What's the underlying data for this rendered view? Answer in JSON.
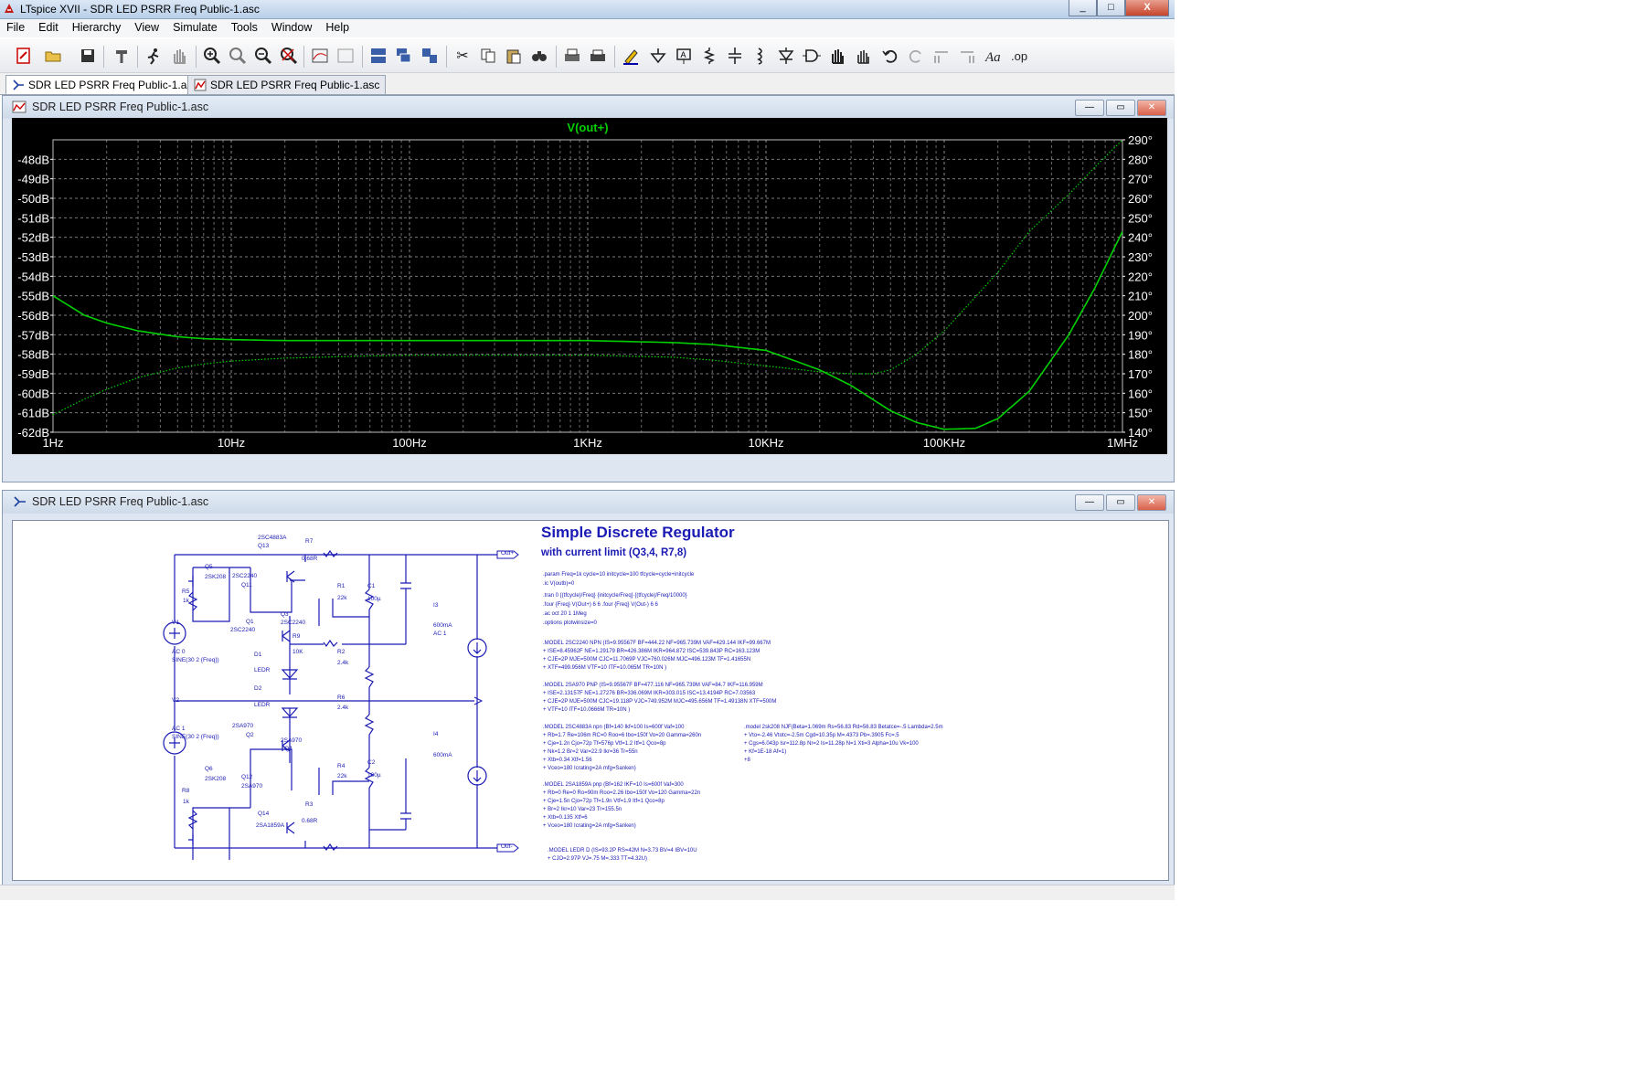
{
  "app": {
    "title": "LTspice XVII - SDR LED PSRR Freq Public-1.asc",
    "win_min": "_",
    "win_max": "□",
    "win_close": "X"
  },
  "menu": [
    "File",
    "Edit",
    "Hierarchy",
    "View",
    "Simulate",
    "Tools",
    "Window",
    "Help"
  ],
  "tabs": [
    {
      "label": "SDR LED PSRR Freq Public-1.asc",
      "icon": "schematic-icon",
      "active": true
    },
    {
      "label": "SDR LED PSRR Freq Public-1.asc",
      "icon": "waveform-icon",
      "active": false
    }
  ],
  "plot_pane": {
    "title": "SDR LED PSRR Freq Public-1.asc"
  },
  "schematic_pane": {
    "title": "SDR LED PSRR Freq Public-1.asc"
  },
  "chart_data": {
    "type": "line",
    "title": "V(out+)",
    "xscale": "log",
    "xlim": [
      1,
      1000000
    ],
    "x_ticks": [
      "1Hz",
      "10Hz",
      "100Hz",
      "1KHz",
      "10KHz",
      "100KHz",
      "1MHz"
    ],
    "ylim": [
      -62,
      -47
    ],
    "y_ticks": [
      "-48dB",
      "-49dB",
      "-50dB",
      "-51dB",
      "-52dB",
      "-53dB",
      "-54dB",
      "-55dB",
      "-56dB",
      "-57dB",
      "-58dB",
      "-59dB",
      "-60dB",
      "-61dB",
      "-62dB"
    ],
    "y2lim": [
      140,
      290
    ],
    "y2_ticks": [
      "290°",
      "280°",
      "270°",
      "260°",
      "250°",
      "240°",
      "230°",
      "220°",
      "210°",
      "200°",
      "190°",
      "180°",
      "170°",
      "160°",
      "150°",
      "140°"
    ],
    "grid": true,
    "line_color": "#00d000",
    "series": [
      {
        "name": "V(out+)",
        "style": "solid",
        "axis": "left",
        "x": [
          1,
          1.5,
          2,
          3,
          5,
          7,
          10,
          20,
          50,
          100,
          300,
          1000,
          3000,
          5000,
          10000,
          20000,
          30000,
          50000,
          70000,
          100000,
          150000,
          200000,
          300000,
          500000,
          700000,
          1000000
        ],
        "y": [
          -55.0,
          -56.0,
          -56.4,
          -56.8,
          -57.1,
          -57.2,
          -57.25,
          -57.3,
          -57.3,
          -57.3,
          -57.3,
          -57.3,
          -57.4,
          -57.5,
          -57.8,
          -58.8,
          -59.6,
          -60.9,
          -61.5,
          -61.85,
          -61.8,
          -61.3,
          -59.9,
          -57.0,
          -54.6,
          -51.7
        ]
      },
      {
        "name": "V(out+) phase",
        "style": "dotted",
        "axis": "right",
        "x": [
          1,
          1.5,
          2,
          3,
          5,
          7,
          10,
          20,
          50,
          100,
          300,
          1000,
          3000,
          5000,
          10000,
          20000,
          30000,
          40000,
          50000,
          70000,
          100000,
          200000,
          300000,
          500000,
          700000,
          1000000
        ],
        "y": [
          149,
          157,
          162,
          168,
          173,
          175,
          176.5,
          178,
          179,
          179.5,
          179.5,
          179.5,
          178.5,
          177,
          174,
          171,
          170,
          170,
          172,
          180,
          192,
          222,
          243,
          262,
          276,
          290
        ]
      }
    ]
  },
  "schematic": {
    "heading": "Simple Discrete Regulator",
    "subheading": "with current limit (Q3,4, R7,8)",
    "directives": [
      ".param Freq=1k cycle=10 initcycle=100 tfcycle=cycle+initcycle",
      ".ic V(outb)=0",
      ".tran 0 {(tfcycle)/Freq} {initcycle/Freq} {(tfcycle)/Freq/10000}",
      ".four {Freq} V(Out+) 6 6     .four {Freq} V(Out-) 6 6",
      ".ac oct 20 1 1Meg",
      ".options plotwinsize=0"
    ],
    "models_left": [
      [
        ".MODEL 2SC2240 NPN (IS=9.95567F BF=444.22 NF=965.739M VAF=429.144 IKF=99.667M",
        "+ ISE=8.45962F NE=1.29179 BR=426.386M IKR=964.872 ISC=539.843P RC=163.123M",
        "+ CJE=2P MJE=500M CJC=11.7069P VJC=760.026M MJC=496.123M TF=1.41655N",
        "+ XTF=499.956M VTF=10 ITF=10.065M TR=10N )"
      ],
      [
        ".MODEL 2SA970 PNP (IS=9.95567F BF=477.116 NF=965.739M VAF=84.7 IKF=116.959M",
        "+ ISE=2.13157F NE=1.27276 BR=336.069M IKR=303.015 ISC=13.4194P RC=7.03563",
        "+ CJE=2P MJE=500M CJC=19.118P VJC=749.952M MJC=495.656M TF=1.49138N XTF=500M",
        "+ VTF=10 ITF=10.0666M TR=10N )"
      ],
      [
        ".MODEL 2SC4883A npn (Bf=140 Ikf=100 Is=600f Vaf=100",
        "+ Rb=1.7 Re=106m RC=0 Roo=6 Ibo=150f Vo=20 Gamma=260n",
        "+ Cje=1.2n Cjo=72p Tf=576p Vtf=1.2 Itf=1 Qco=8p",
        "+ Nk=1.2 Br=2 Var=22.9 Ikr=36 Tr=55n",
        "+ Xtb=0.34 Xtf=1.56",
        "+ Vceo=180 Icrating=2A mfg=Sanken)"
      ],
      [
        ".MODEL 2SA1859A pnp (Bf=162 IKF=10 Is=600f Vaf=300",
        "+ Rb=0 Re=0 Ro=90m Roo=2.26 Ibo=150f Vo=120 Gamma=22n",
        "+ Cje=1.5n Cjo=72p Tf=1.9n Vtf=1.9 Itf=1 Qco=8p",
        "+ Br=2 Ikr=10 Var=23 Tr=155.5n",
        "+ Xtb=0.135 Xtf=6",
        "+ Vceo=180 Icrating=2A mfg=Sanken)"
      ],
      [
        ".MODEL LEDR D (IS=93.2P RS=42M N=3.73 BV=4 IBV=10U",
        "+ CJO=2.97P VJ=.75 M=.333 TT=4.32U)"
      ]
    ],
    "model_right": [
      ".model 2sk208  NJF(Beta=1.069m Rs=56.83 Rd=56.83 Betatce=-.5 Lambda=2.5m",
      "+              Vto=-2.46 Vtotc=-2.5m Cgd=10.35p M=.4373 Pb=.3905 Fc=.5",
      "+              Cgs=6.043p Isr=112.8p Nr=2 Is=11.28p N=1 Xti=3 Alpha=10u Vk=100",
      "+              Kf=1E-18 Af=1)",
      "+8"
    ],
    "labels": {
      "q13": "2SC4883A",
      "q13n": "Q13",
      "q5": "Q5",
      "q5m": "2SK208",
      "r5": "R5",
      "r5v": "1k",
      "q11m": "2SC2240",
      "q11": "Q11",
      "r7": "R7",
      "r7v": "0.68R",
      "r1": "R1",
      "r1v": "22k",
      "c1": "C1",
      "c1v": "100µ",
      "q3": "Q3",
      "q3m": "2SC2240",
      "q1": "Q1",
      "q1m": "2SC2240",
      "v1": "V1",
      "v1ac": "AC 0",
      "v1sine": "SINE(30 2 {Freq})",
      "r9": "R9",
      "r9v": "10K",
      "d1": "D1",
      "d1m": "LEDR",
      "r2": "R2",
      "r2v": "2.4k",
      "i3": "I3",
      "i3v": "600mA",
      "i3ac": "AC 1",
      "d2": "D2",
      "d2m": "LEDR",
      "r6": "R6",
      "r6v": "2.4k",
      "v2": "V2",
      "v2ac": "AC 1",
      "v2sine": "SINE(30 2 {Freq})",
      "q2m": "2SA970",
      "q2": "Q2",
      "q4m": "2SA970",
      "q4": "Q4",
      "i4": "I4",
      "i4v": "600mA",
      "c2": "C2",
      "c2v": "100µ",
      "r4": "R4",
      "r4v": "22k",
      "q6": "Q6",
      "q6m": "2SK208",
      "r8": "R8",
      "r8v": "1k",
      "q12": "Q12",
      "q12m": "2SA970",
      "r3": "R3",
      "r3v": "0.68R",
      "q14": "Q14",
      "q14m": "2SA1859A",
      "outp": "Out+",
      "outn": "Out-"
    }
  }
}
